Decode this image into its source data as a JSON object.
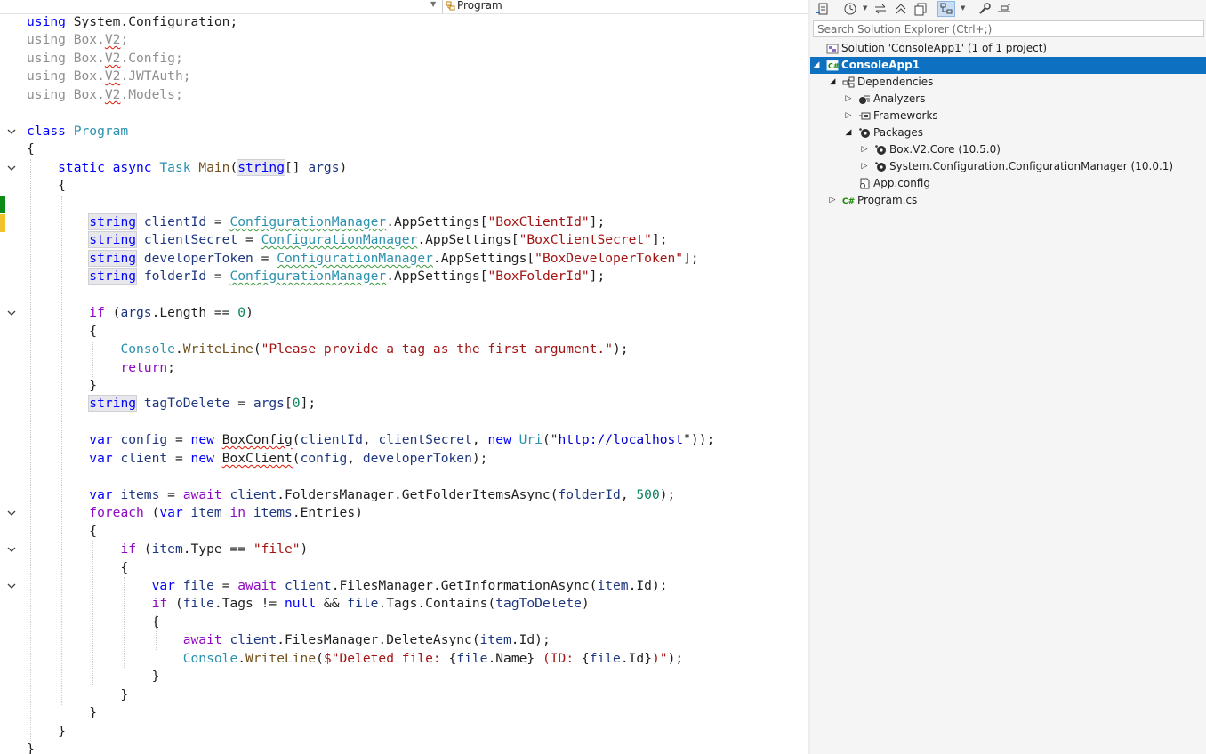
{
  "editor": {
    "nav_bar": {
      "class_label": "Program"
    },
    "code_lines": [
      [
        {
          "t": "using ",
          "c": "kw"
        },
        {
          "t": "System.Configuration;",
          "c": ""
        }
      ],
      [
        {
          "t": "using Box.",
          "c": "dim"
        },
        {
          "t": "V2",
          "c": "dim sq-red"
        },
        {
          "t": ";",
          "c": "dim"
        }
      ],
      [
        {
          "t": "using Box.",
          "c": "dim"
        },
        {
          "t": "V2",
          "c": "dim sq-red"
        },
        {
          "t": ".Config;",
          "c": "dim"
        }
      ],
      [
        {
          "t": "using Box.",
          "c": "dim"
        },
        {
          "t": "V2",
          "c": "dim sq-red"
        },
        {
          "t": ".JWTAuth;",
          "c": "dim"
        }
      ],
      [
        {
          "t": "using Box.",
          "c": "dim"
        },
        {
          "t": "V2",
          "c": "dim sq-red"
        },
        {
          "t": ".Models;",
          "c": "dim"
        }
      ],
      [],
      [
        {
          "t": "class ",
          "c": "kw"
        },
        {
          "t": "Program",
          "c": "type"
        }
      ],
      [
        {
          "t": "{",
          "c": ""
        }
      ],
      [
        {
          "t": "    static async ",
          "c": "kw"
        },
        {
          "t": "Task ",
          "c": "type"
        },
        {
          "t": "Main",
          "c": "method"
        },
        {
          "t": "(",
          "c": ""
        },
        {
          "t": "string",
          "c": "kw hl"
        },
        {
          "t": "[] ",
          "c": ""
        },
        {
          "t": "args",
          "c": "ident"
        },
        {
          "t": ")",
          "c": ""
        }
      ],
      [
        {
          "t": "    {",
          "c": ""
        }
      ],
      [],
      [
        {
          "t": "        ",
          "c": ""
        },
        {
          "t": "string",
          "c": "kw hl"
        },
        {
          "t": " ",
          "c": ""
        },
        {
          "t": "clientId",
          "c": "ident"
        },
        {
          "t": " = ",
          "c": ""
        },
        {
          "t": "ConfigurationManager",
          "c": "type sq-green"
        },
        {
          "t": ".AppSettings[",
          "c": ""
        },
        {
          "t": "\"BoxClientId\"",
          "c": "str"
        },
        {
          "t": "];",
          "c": ""
        }
      ],
      [
        {
          "t": "        ",
          "c": ""
        },
        {
          "t": "string",
          "c": "kw hl"
        },
        {
          "t": " ",
          "c": ""
        },
        {
          "t": "clientSecret",
          "c": "ident"
        },
        {
          "t": " = ",
          "c": ""
        },
        {
          "t": "ConfigurationManager",
          "c": "type sq-green"
        },
        {
          "t": ".AppSettings[",
          "c": ""
        },
        {
          "t": "\"BoxClientSecret\"",
          "c": "str"
        },
        {
          "t": "];",
          "c": ""
        }
      ],
      [
        {
          "t": "        ",
          "c": ""
        },
        {
          "t": "string",
          "c": "kw hl"
        },
        {
          "t": " ",
          "c": ""
        },
        {
          "t": "developerToken",
          "c": "ident"
        },
        {
          "t": " = ",
          "c": ""
        },
        {
          "t": "ConfigurationManager",
          "c": "type sq-green"
        },
        {
          "t": ".AppSettings[",
          "c": ""
        },
        {
          "t": "\"BoxDeveloperToken\"",
          "c": "str"
        },
        {
          "t": "];",
          "c": ""
        }
      ],
      [
        {
          "t": "        ",
          "c": ""
        },
        {
          "t": "string",
          "c": "kw hl"
        },
        {
          "t": " ",
          "c": ""
        },
        {
          "t": "folderId",
          "c": "ident"
        },
        {
          "t": " = ",
          "c": ""
        },
        {
          "t": "ConfigurationManager",
          "c": "type sq-green"
        },
        {
          "t": ".AppSettings[",
          "c": ""
        },
        {
          "t": "\"BoxFolderId\"",
          "c": "str"
        },
        {
          "t": "];",
          "c": ""
        }
      ],
      [],
      [
        {
          "t": "        ",
          "c": ""
        },
        {
          "t": "if",
          "c": "ctl"
        },
        {
          "t": " (",
          "c": ""
        },
        {
          "t": "args",
          "c": "ident"
        },
        {
          "t": ".Length == ",
          "c": ""
        },
        {
          "t": "0",
          "c": "num"
        },
        {
          "t": ")",
          "c": ""
        }
      ],
      [
        {
          "t": "        {",
          "c": ""
        }
      ],
      [
        {
          "t": "            ",
          "c": ""
        },
        {
          "t": "Console",
          "c": "type"
        },
        {
          "t": ".",
          "c": ""
        },
        {
          "t": "WriteLine",
          "c": "method"
        },
        {
          "t": "(",
          "c": ""
        },
        {
          "t": "\"Please provide a tag as the first argument.\"",
          "c": "str"
        },
        {
          "t": ");",
          "c": ""
        }
      ],
      [
        {
          "t": "            ",
          "c": ""
        },
        {
          "t": "return",
          "c": "ctl"
        },
        {
          "t": ";",
          "c": ""
        }
      ],
      [
        {
          "t": "        }",
          "c": ""
        }
      ],
      [
        {
          "t": "        ",
          "c": ""
        },
        {
          "t": "string",
          "c": "kw hl"
        },
        {
          "t": " ",
          "c": ""
        },
        {
          "t": "tagToDelete",
          "c": "ident"
        },
        {
          "t": " = ",
          "c": ""
        },
        {
          "t": "args",
          "c": "ident"
        },
        {
          "t": "[",
          "c": ""
        },
        {
          "t": "0",
          "c": "num"
        },
        {
          "t": "];",
          "c": ""
        }
      ],
      [],
      [
        {
          "t": "        ",
          "c": ""
        },
        {
          "t": "var",
          "c": "kw"
        },
        {
          "t": " ",
          "c": ""
        },
        {
          "t": "config",
          "c": "ident"
        },
        {
          "t": " = ",
          "c": ""
        },
        {
          "t": "new",
          "c": "kw"
        },
        {
          "t": " ",
          "c": ""
        },
        {
          "t": "BoxConfig",
          "c": "sq-red"
        },
        {
          "t": "(",
          "c": ""
        },
        {
          "t": "clientId",
          "c": "ident"
        },
        {
          "t": ", ",
          "c": ""
        },
        {
          "t": "clientSecret",
          "c": "ident"
        },
        {
          "t": ", ",
          "c": ""
        },
        {
          "t": "new",
          "c": "kw"
        },
        {
          "t": " ",
          "c": ""
        },
        {
          "t": "Uri",
          "c": "type"
        },
        {
          "t": "(\"",
          "c": ""
        },
        {
          "t": "http://localhost",
          "c": "url"
        },
        {
          "t": "\"));",
          "c": ""
        }
      ],
      [
        {
          "t": "        ",
          "c": ""
        },
        {
          "t": "var",
          "c": "kw"
        },
        {
          "t": " ",
          "c": ""
        },
        {
          "t": "client",
          "c": "ident"
        },
        {
          "t": " = ",
          "c": ""
        },
        {
          "t": "new",
          "c": "kw"
        },
        {
          "t": " ",
          "c": ""
        },
        {
          "t": "BoxClient",
          "c": "sq-red"
        },
        {
          "t": "(",
          "c": ""
        },
        {
          "t": "config",
          "c": "ident"
        },
        {
          "t": ", ",
          "c": ""
        },
        {
          "t": "developerToken",
          "c": "ident"
        },
        {
          "t": ");",
          "c": ""
        }
      ],
      [],
      [
        {
          "t": "        ",
          "c": ""
        },
        {
          "t": "var",
          "c": "kw"
        },
        {
          "t": " ",
          "c": ""
        },
        {
          "t": "items",
          "c": "ident"
        },
        {
          "t": " = ",
          "c": ""
        },
        {
          "t": "await",
          "c": "ctl"
        },
        {
          "t": " ",
          "c": ""
        },
        {
          "t": "client",
          "c": "ident"
        },
        {
          "t": ".FoldersManager.GetFolderItemsAsync(",
          "c": ""
        },
        {
          "t": "folderId",
          "c": "ident"
        },
        {
          "t": ", ",
          "c": ""
        },
        {
          "t": "500",
          "c": "num"
        },
        {
          "t": ");",
          "c": ""
        }
      ],
      [
        {
          "t": "        ",
          "c": ""
        },
        {
          "t": "foreach",
          "c": "ctl"
        },
        {
          "t": " (",
          "c": ""
        },
        {
          "t": "var",
          "c": "kw"
        },
        {
          "t": " ",
          "c": ""
        },
        {
          "t": "item",
          "c": "ident"
        },
        {
          "t": " ",
          "c": ""
        },
        {
          "t": "in",
          "c": "ctl"
        },
        {
          "t": " ",
          "c": ""
        },
        {
          "t": "items",
          "c": "ident"
        },
        {
          "t": ".Entries)",
          "c": ""
        }
      ],
      [
        {
          "t": "        {",
          "c": ""
        }
      ],
      [
        {
          "t": "            ",
          "c": ""
        },
        {
          "t": "if",
          "c": "ctl"
        },
        {
          "t": " (",
          "c": ""
        },
        {
          "t": "item",
          "c": "ident"
        },
        {
          "t": ".Type == ",
          "c": ""
        },
        {
          "t": "\"file\"",
          "c": "str"
        },
        {
          "t": ")",
          "c": ""
        }
      ],
      [
        {
          "t": "            {",
          "c": ""
        }
      ],
      [
        {
          "t": "                ",
          "c": ""
        },
        {
          "t": "var",
          "c": "kw"
        },
        {
          "t": " ",
          "c": ""
        },
        {
          "t": "file",
          "c": "ident"
        },
        {
          "t": " = ",
          "c": ""
        },
        {
          "t": "await",
          "c": "ctl"
        },
        {
          "t": " ",
          "c": ""
        },
        {
          "t": "client",
          "c": "ident"
        },
        {
          "t": ".FilesManager.GetInformationAsync(",
          "c": ""
        },
        {
          "t": "item",
          "c": "ident"
        },
        {
          "t": ".Id);",
          "c": ""
        }
      ],
      [
        {
          "t": "                ",
          "c": ""
        },
        {
          "t": "if",
          "c": "ctl"
        },
        {
          "t": " (",
          "c": ""
        },
        {
          "t": "file",
          "c": "ident"
        },
        {
          "t": ".Tags != ",
          "c": ""
        },
        {
          "t": "null",
          "c": "kw"
        },
        {
          "t": " && ",
          "c": ""
        },
        {
          "t": "file",
          "c": "ident"
        },
        {
          "t": ".Tags.Contains(",
          "c": ""
        },
        {
          "t": "tagToDelete",
          "c": "ident"
        },
        {
          "t": ")",
          "c": ""
        }
      ],
      [
        {
          "t": "                {",
          "c": ""
        }
      ],
      [
        {
          "t": "                    ",
          "c": ""
        },
        {
          "t": "await",
          "c": "ctl"
        },
        {
          "t": " ",
          "c": ""
        },
        {
          "t": "client",
          "c": "ident"
        },
        {
          "t": ".FilesManager.DeleteAsync(",
          "c": ""
        },
        {
          "t": "item",
          "c": "ident"
        },
        {
          "t": ".Id);",
          "c": ""
        }
      ],
      [
        {
          "t": "                    ",
          "c": ""
        },
        {
          "t": "Console",
          "c": "type"
        },
        {
          "t": ".",
          "c": ""
        },
        {
          "t": "WriteLine",
          "c": "method"
        },
        {
          "t": "(",
          "c": ""
        },
        {
          "t": "$\"Deleted file: ",
          "c": "str"
        },
        {
          "t": "{",
          "c": ""
        },
        {
          "t": "file",
          "c": "ident"
        },
        {
          "t": ".Name}",
          "c": ""
        },
        {
          "t": " (ID: ",
          "c": "str"
        },
        {
          "t": "{",
          "c": ""
        },
        {
          "t": "file",
          "c": "ident"
        },
        {
          "t": ".Id}",
          "c": ""
        },
        {
          "t": ")\"",
          "c": "str"
        },
        {
          "t": ");",
          "c": ""
        }
      ],
      [
        {
          "t": "                }",
          "c": ""
        }
      ],
      [
        {
          "t": "            }",
          "c": ""
        }
      ],
      [
        {
          "t": "        }",
          "c": ""
        }
      ],
      [
        {
          "t": "    }",
          "c": ""
        }
      ],
      [
        {
          "t": "}",
          "c": ""
        }
      ]
    ]
  },
  "solution_explorer": {
    "search_placeholder": "Search Solution Explorer (Ctrl+;)",
    "tree": [
      {
        "label": "Solution 'ConsoleApp1' (1 of 1 project)",
        "icon": "solution-icon",
        "expander": ""
      },
      {
        "label": "ConsoleApp1",
        "icon": "csharp-project-icon",
        "expander": "expanded",
        "selected": true
      },
      {
        "label": "Dependencies",
        "icon": "dependencies-icon",
        "expander": "expanded"
      },
      {
        "label": "Analyzers",
        "icon": "analyzers-icon",
        "expander": "collapsed"
      },
      {
        "label": "Frameworks",
        "icon": "frameworks-icon",
        "expander": "collapsed"
      },
      {
        "label": "Packages",
        "icon": "packages-icon",
        "expander": "expanded"
      },
      {
        "label": "Box.V2.Core (10.5.0)",
        "icon": "package-icon",
        "expander": "collapsed"
      },
      {
        "label": "System.Configuration.ConfigurationManager (10.0.1)",
        "icon": "package-icon",
        "expander": "collapsed"
      },
      {
        "label": "App.config",
        "icon": "config-file-icon",
        "expander": ""
      },
      {
        "label": "Program.cs",
        "icon": "csharp-file-icon",
        "expander": "collapsed"
      }
    ]
  }
}
